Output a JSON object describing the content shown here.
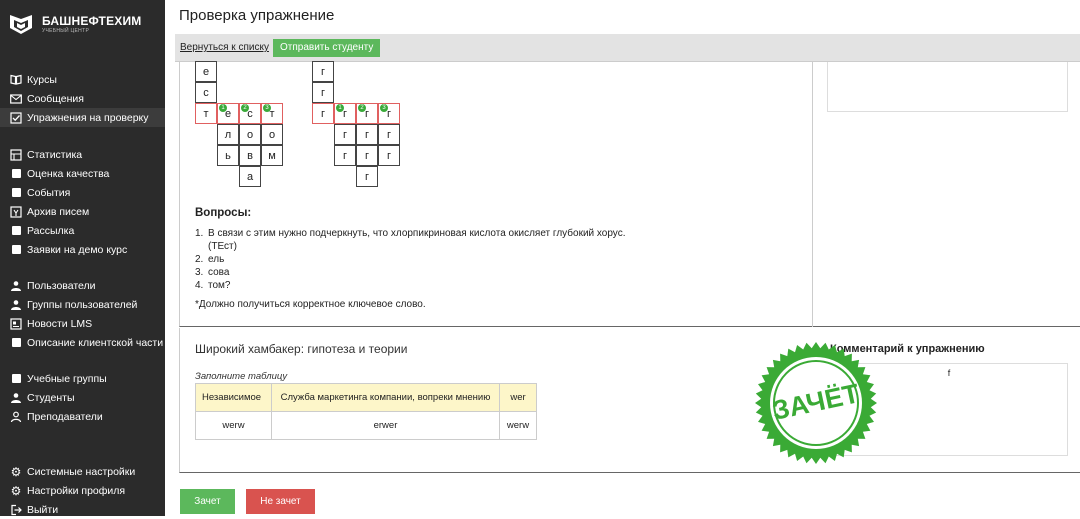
{
  "brand": {
    "title": "БАШНЕФТЕХИМ",
    "subtitle": "УЧЕБНЫЙ ЦЕНТР"
  },
  "sidebar": {
    "group1": [
      {
        "label": "Курсы",
        "icon": "book-icon"
      },
      {
        "label": "Сообщения",
        "icon": "mail-icon"
      },
      {
        "label": "Упражнения на проверку",
        "icon": "checkbox-icon",
        "active": true
      }
    ],
    "group2": [
      {
        "label": "Статистика",
        "icon": "chart-icon"
      },
      {
        "label": "Оценка качества",
        "icon": "square-icon"
      },
      {
        "label": "События",
        "icon": "square-icon"
      },
      {
        "label": "Архив писем",
        "icon": "archive-icon"
      },
      {
        "label": "Рассылка",
        "icon": "square-icon"
      },
      {
        "label": "Заявки на демо курс",
        "icon": "square-icon"
      }
    ],
    "group3": [
      {
        "label": "Пользователи",
        "icon": "users-icon"
      },
      {
        "label": "Группы пользователей",
        "icon": "users-icon"
      },
      {
        "label": "Новости LMS",
        "icon": "news-icon"
      },
      {
        "label": "Описание клиентской части",
        "icon": "square-icon"
      }
    ],
    "group4": [
      {
        "label": "Учебные группы",
        "icon": "square-icon"
      },
      {
        "label": "Студенты",
        "icon": "users-icon"
      },
      {
        "label": "Преподаватели",
        "icon": "user-icon"
      }
    ],
    "group5": [
      {
        "label": "Системные настройки",
        "icon": "gear-icon"
      },
      {
        "label": "Настройки профиля",
        "icon": "gear-icon"
      },
      {
        "label": "Выйти",
        "icon": "logout-icon"
      }
    ]
  },
  "header": {
    "title": "Проверка упражнение"
  },
  "toolbar": {
    "back_label": "Вернуться к списку",
    "send_label": "Отправить студенту"
  },
  "crossword": {
    "left": {
      "cells": [
        {
          "r": 0,
          "c": 0,
          "ch": "е"
        },
        {
          "r": 1,
          "c": 0,
          "ch": "с"
        },
        {
          "r": 2,
          "c": 0,
          "ch": "т"
        },
        {
          "r": 2,
          "c": 1,
          "ch": "е",
          "badge": "1"
        },
        {
          "r": 2,
          "c": 2,
          "ch": "с",
          "badge": "2"
        },
        {
          "r": 2,
          "c": 3,
          "ch": "т",
          "badge": "3"
        },
        {
          "r": 3,
          "c": 1,
          "ch": "л"
        },
        {
          "r": 3,
          "c": 2,
          "ch": "о"
        },
        {
          "r": 3,
          "c": 3,
          "ch": "о"
        },
        {
          "r": 4,
          "c": 1,
          "ch": "ь"
        },
        {
          "r": 4,
          "c": 2,
          "ch": "в"
        },
        {
          "r": 4,
          "c": 3,
          "ch": "м"
        },
        {
          "r": 5,
          "c": 2,
          "ch": "а"
        }
      ]
    },
    "right": {
      "cells": [
        {
          "r": 0,
          "c": 0,
          "ch": "г"
        },
        {
          "r": 1,
          "c": 0,
          "ch": "г"
        },
        {
          "r": 2,
          "c": 0,
          "ch": "г"
        },
        {
          "r": 2,
          "c": 1,
          "ch": "г",
          "badge": "1"
        },
        {
          "r": 2,
          "c": 2,
          "ch": "г",
          "badge": "2"
        },
        {
          "r": 2,
          "c": 3,
          "ch": "г",
          "badge": "3"
        },
        {
          "r": 3,
          "c": 1,
          "ch": "г"
        },
        {
          "r": 3,
          "c": 2,
          "ch": "г"
        },
        {
          "r": 3,
          "c": 3,
          "ch": "г"
        },
        {
          "r": 4,
          "c": 1,
          "ch": "г"
        },
        {
          "r": 4,
          "c": 2,
          "ch": "г"
        },
        {
          "r": 4,
          "c": 3,
          "ch": "г"
        },
        {
          "r": 5,
          "c": 2,
          "ch": "г"
        }
      ]
    }
  },
  "questions": {
    "title": "Вопросы:",
    "items": [
      {
        "num": "1.",
        "text": "В связи с этим нужно подчеркнуть, что хлорпикриновая кислота окисляет глубокий хорус."
      },
      {
        "num": "",
        "text": "(ТЕст)"
      },
      {
        "num": "2.",
        "text": "ель"
      },
      {
        "num": "3.",
        "text": "сова"
      },
      {
        "num": "4.",
        "text": "том?"
      }
    ],
    "note": "*Должно получиться корректное ключевое слово."
  },
  "exercise": {
    "title": "Широкий хамбакер: гипотеза и теории",
    "fill_label": "Заполните таблицу",
    "table": {
      "header": [
        "Независимое",
        "Служба маркетинга компании, вопреки мнению",
        "wer"
      ],
      "row": [
        "werw",
        "erwer",
        "werw"
      ]
    }
  },
  "comment": {
    "title": "Комментарий к упражнению",
    "text": "f"
  },
  "stamp": {
    "text": "ЗАЧЁТ",
    "color": "#3aaa35"
  },
  "actions": {
    "pass_label": "Зачет",
    "fail_label": "Не зачет"
  },
  "colors": {
    "sidebar_bg": "#2b2b2b",
    "green": "#5cb85c",
    "red": "#d9534f",
    "key_outline": "#e06060"
  }
}
